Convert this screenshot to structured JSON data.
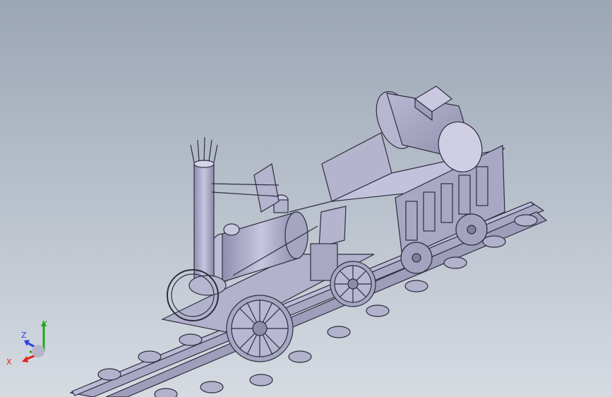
{
  "viewport": {
    "background_top": "#9ba6b5",
    "background_bottom": "#d6dbe2",
    "model_fill": "#a7a6c3",
    "model_stroke": "#2e2d3f"
  },
  "triad": {
    "x_label": "X",
    "y_label": "Y",
    "z_label": "Z",
    "x_color": "#e0251b",
    "y_color": "#1ea81e",
    "z_color": "#2b3fe0"
  }
}
